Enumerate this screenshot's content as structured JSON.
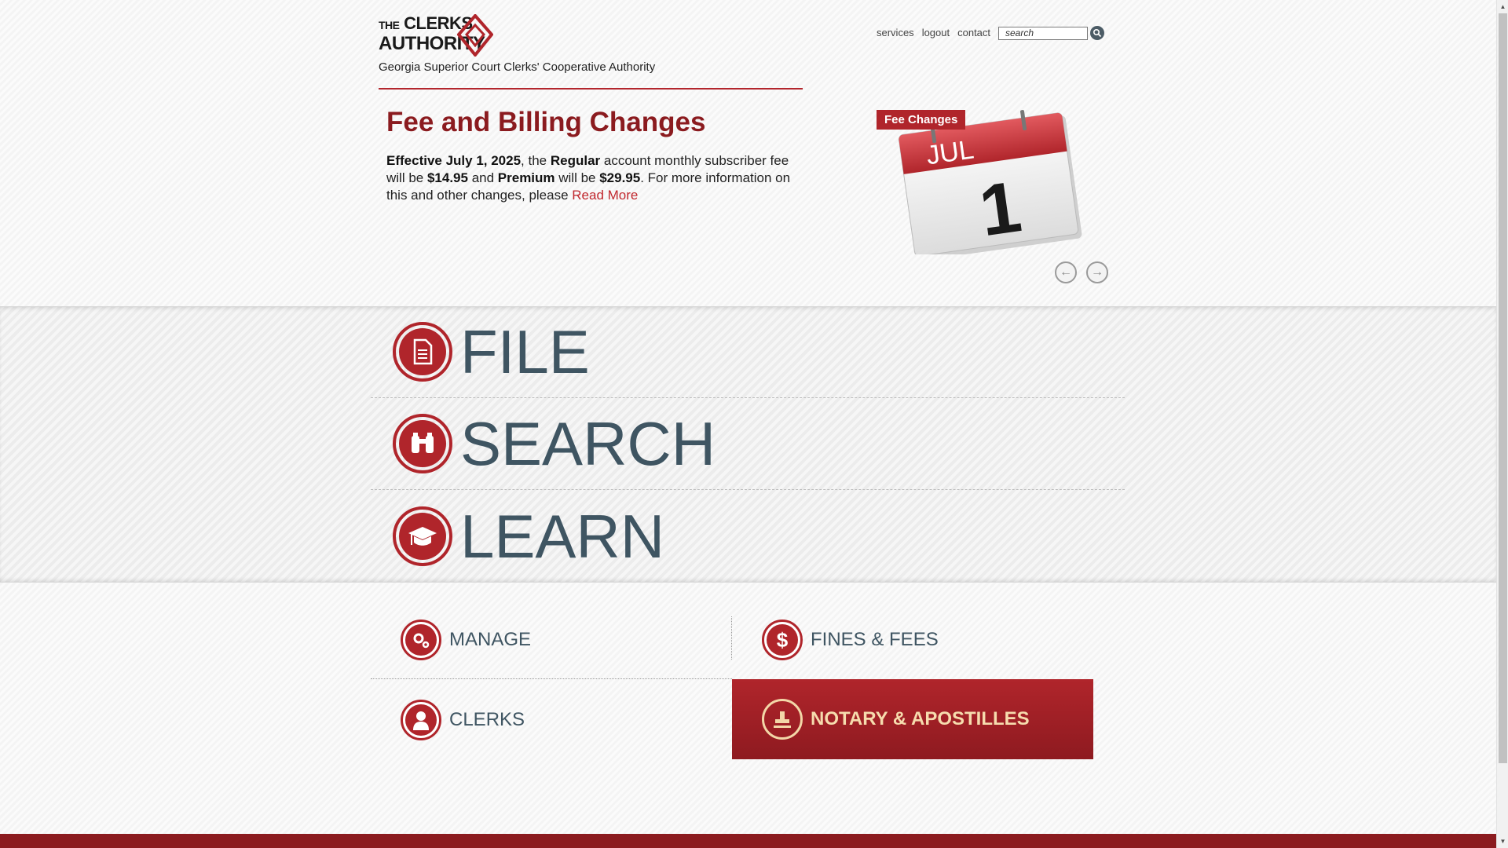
{
  "site": {
    "logo_line1_small": "THE",
    "logo_line1": "CLERKS",
    "logo_line2": "AUTHORITY",
    "tagline": "Georgia Superior Court Clerks' Cooperative Authority"
  },
  "topnav": {
    "items": [
      "services",
      "logout",
      "contact"
    ],
    "search_placeholder": "search"
  },
  "feature": {
    "title": "Fee and Billing Changes",
    "effective_label": "Effective July 1, 2025",
    "text1": ", the ",
    "regular_label": "Regular",
    "text2": " account monthly subscriber fee will be ",
    "regular_price": "$14.95",
    "text3": " and ",
    "premium_label": "Premium",
    "text4": " will be ",
    "premium_price": "$29.95",
    "text5": ". For more information on this and other changes, please ",
    "link_label": "Read More"
  },
  "slide": {
    "badge": "Fee Changes",
    "calendar_month": "JUL",
    "calendar_day": "1"
  },
  "big_nav": [
    "FILE",
    "SEARCH",
    "LEARN"
  ],
  "grid_nav": [
    "MANAGE",
    "FINES & FEES",
    "CLERKS",
    "NOTARY & APOSTILLES"
  ],
  "colors": {
    "accent": "#b0252b",
    "dark_red": "#8b1b1f",
    "slate": "#3f5562",
    "highlight_text": "#f6dcae"
  }
}
